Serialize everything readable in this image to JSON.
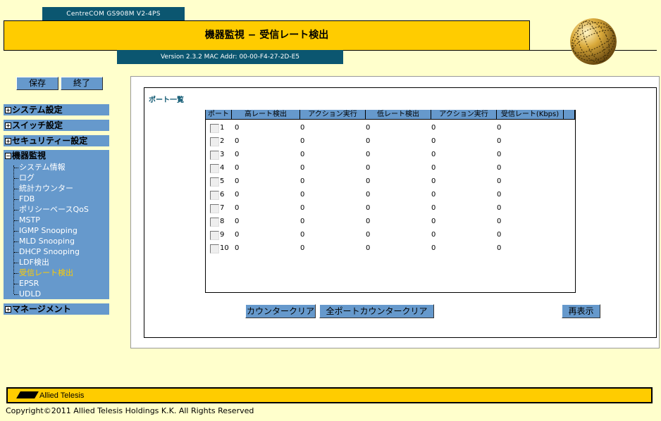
{
  "header": {
    "model": "CentreCOM GS908M V2-4PS",
    "title": "機器監視 − 受信レート検出",
    "version": "Version 2.3.2 MAC Addr: 00-00-F4-27-2D-E5"
  },
  "left_buttons": {
    "save": "保存",
    "exit": "終了"
  },
  "sidebar": {
    "system": "システム設定",
    "switch": "スイッチ設定",
    "security": "セキュリティー設定",
    "monitor": "機器監視",
    "monitor_items": [
      "システム情報",
      "ログ",
      "統計カウンター",
      "FDB",
      "ポリシーベースQoS",
      "MSTP",
      "IGMP Snooping",
      "MLD Snooping",
      "DHCP Snooping",
      "LDF検出",
      "受信レート検出",
      "EPSR",
      "UDLD"
    ],
    "management": "マネージメント"
  },
  "main": {
    "section_title": "ポート一覧",
    "columns": [
      "ポート",
      "高レート検出",
      "アクション実行",
      "低レート検出",
      "アクション実行",
      "受信レート(Kbps)"
    ],
    "rows": [
      [
        "1",
        "0",
        "0",
        "0",
        "0",
        "0"
      ],
      [
        "2",
        "0",
        "0",
        "0",
        "0",
        "0"
      ],
      [
        "3",
        "0",
        "0",
        "0",
        "0",
        "0"
      ],
      [
        "4",
        "0",
        "0",
        "0",
        "0",
        "0"
      ],
      [
        "5",
        "0",
        "0",
        "0",
        "0",
        "0"
      ],
      [
        "6",
        "0",
        "0",
        "0",
        "0",
        "0"
      ],
      [
        "7",
        "0",
        "0",
        "0",
        "0",
        "0"
      ],
      [
        "8",
        "0",
        "0",
        "0",
        "0",
        "0"
      ],
      [
        "9",
        "0",
        "0",
        "0",
        "0",
        "0"
      ],
      [
        "10",
        "0",
        "0",
        "0",
        "0",
        "0"
      ]
    ],
    "buttons": {
      "counter_clear": "カウンタークリア",
      "all_port_clear": "全ポートカウンタークリア",
      "refresh": "再表示"
    }
  },
  "footer": {
    "logo_text": "Allied Telesis",
    "copyright": "Copyright©2011 Allied Telesis Holdings K.K. All Rights Reserved"
  },
  "colors": {
    "accent_yellow": "#ffcc00",
    "nav_blue": "#6699cc",
    "header_teal": "#0b5670",
    "background": "#ffffcc",
    "active_item": "#ffcc00"
  },
  "icons": {
    "expand": "plus-box-icon",
    "collapse": "minus-box-icon",
    "globe": "globe-logo-icon"
  }
}
